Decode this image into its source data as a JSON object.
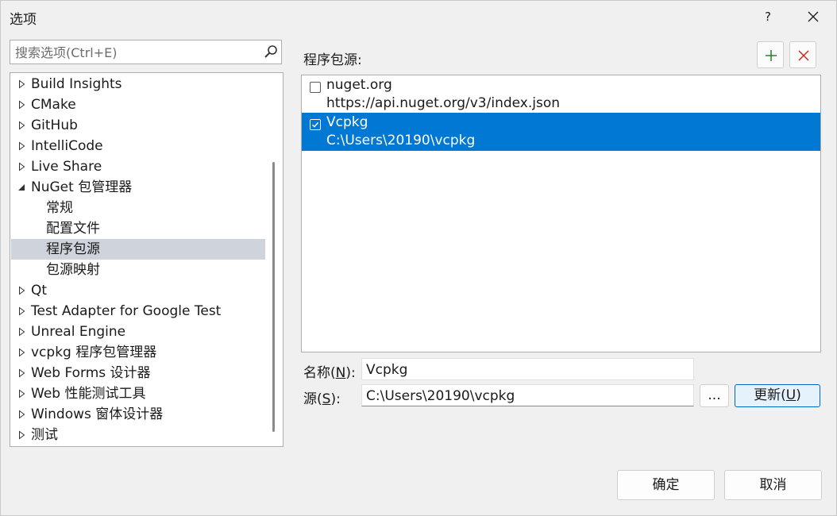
{
  "window": {
    "title": "选项",
    "help_label": "?"
  },
  "search": {
    "placeholder": "搜索选项(Ctrl+E)"
  },
  "tree": {
    "items": [
      {
        "label": "Build Insights",
        "expanded": false
      },
      {
        "label": "CMake",
        "expanded": false
      },
      {
        "label": "GitHub",
        "expanded": false
      },
      {
        "label": "IntelliCode",
        "expanded": false
      },
      {
        "label": "Live Share",
        "expanded": false
      },
      {
        "label": "NuGet 包管理器",
        "expanded": true
      },
      {
        "label": "常规",
        "child": true
      },
      {
        "label": "配置文件",
        "child": true
      },
      {
        "label": "程序包源",
        "child": true,
        "selected": true
      },
      {
        "label": "包源映射",
        "child": true
      },
      {
        "label": "Qt",
        "expanded": false
      },
      {
        "label": "Test Adapter for Google Test",
        "expanded": false
      },
      {
        "label": "Unreal Engine",
        "expanded": false
      },
      {
        "label": "vcpkg 程序包管理器",
        "expanded": false
      },
      {
        "label": "Web Forms 设计器",
        "expanded": false
      },
      {
        "label": "Web 性能测试工具",
        "expanded": false
      },
      {
        "label": "Windows 窗体设计器",
        "expanded": false
      },
      {
        "label": "测试",
        "expanded": false
      }
    ]
  },
  "sources": {
    "label": "程序包源:",
    "items": [
      {
        "name": "nuget.org",
        "url": "https://api.nuget.org/v3/index.json",
        "checked": false,
        "selected": false
      },
      {
        "name": "Vcpkg",
        "url": "C:\\Users\\20190\\vcpkg",
        "checked": true,
        "selected": true
      }
    ]
  },
  "form": {
    "name_label_pre": "名称(",
    "name_key": "N",
    "name_label_post": "):",
    "name_value": "Vcpkg",
    "source_label_pre": "源(",
    "source_key": "S",
    "source_label_post": "):",
    "source_value": "C:\\Users\\20190\\vcpkg",
    "browse_label": "...",
    "update_label_pre": "更新(",
    "update_key": "U",
    "update_label_post": ")"
  },
  "footer": {
    "ok_label": "确定",
    "cancel_label": "取消"
  },
  "colors": {
    "accent": "#0078d4",
    "selection": "#cfd3dc",
    "add_icon": "#2e7d32",
    "delete_icon": "#c42b1c"
  }
}
